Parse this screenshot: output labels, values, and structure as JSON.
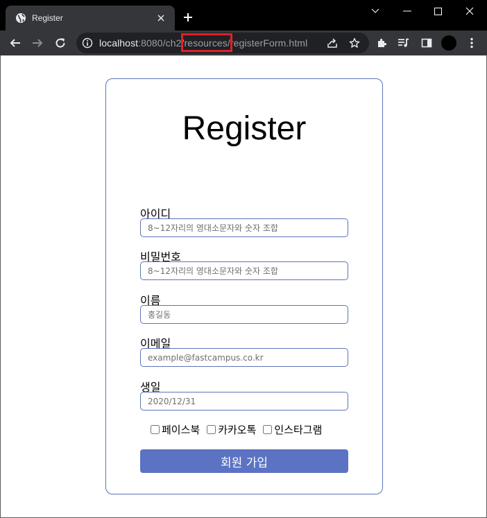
{
  "browser": {
    "tab_title": "Register",
    "url_host": "localhost",
    "url_rest": ":8080/ch2/resources/registerForm.html"
  },
  "form": {
    "title": "Register",
    "fields": [
      {
        "label": "아이디",
        "placeholder": "8~12자리의 영대소문자와 숫자 조합"
      },
      {
        "label": "비밀번호",
        "placeholder": "8~12자리의 영대소문자와 숫자 조합"
      },
      {
        "label": "이름",
        "placeholder": "홍길동"
      },
      {
        "label": "이메일",
        "placeholder": "example@fastcampus.co.kr"
      },
      {
        "label": "생일",
        "placeholder": "2020/12/31"
      }
    ],
    "sns": [
      "페이스북",
      "카카오톡",
      "인스타그램"
    ],
    "submit_label": "회원 가입"
  },
  "colors": {
    "accent": "#5b73c2",
    "border": "#5b73b8",
    "highlight": "#e0202a"
  }
}
